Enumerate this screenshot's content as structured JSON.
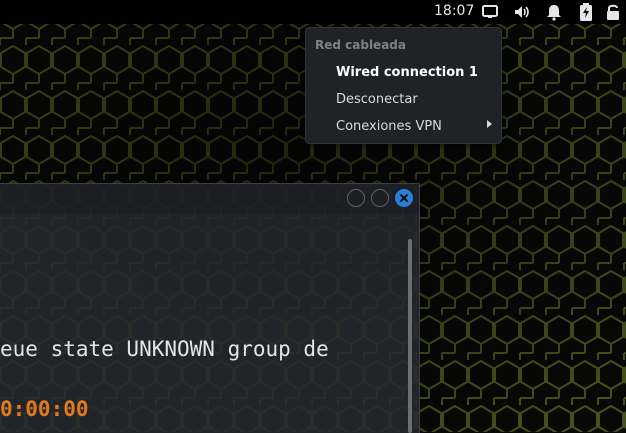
{
  "topbar": {
    "clock": "18:07",
    "icons": [
      "screen-icon",
      "volume-icon",
      "notification-bell-icon",
      "battery-charging-icon",
      "lock-icon"
    ]
  },
  "network_menu": {
    "section_title": "Red cableada",
    "items": [
      {
        "label": "Wired connection 1",
        "active": true
      },
      {
        "label": "Desconectar",
        "active": false
      },
      {
        "label": "Conexiones VPN",
        "has_submenu": true
      }
    ]
  },
  "terminal": {
    "lines": [
      "eue state UNKNOWN group de",
      "0:00:00"
    ]
  },
  "colors": {
    "close_button": "#2a7ed8",
    "timer_text": "#e07a1d",
    "hex_grid": "#5a6a22"
  }
}
